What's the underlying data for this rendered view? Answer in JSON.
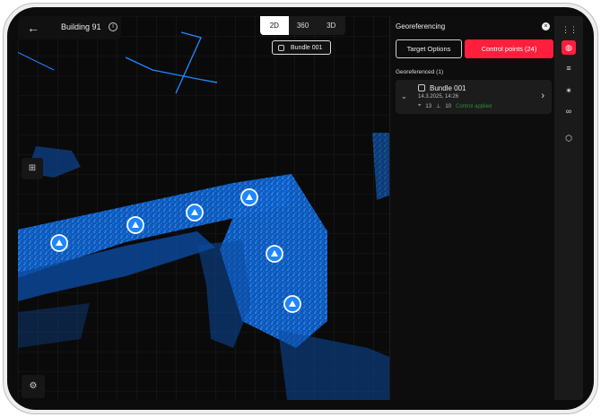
{
  "header": {
    "back_icon": "arrow-left-icon",
    "title": "Building 91",
    "info_icon": "info-icon"
  },
  "view_modes": {
    "options": [
      "2D",
      "360",
      "3D"
    ],
    "selected": "2D"
  },
  "bundle_chip": {
    "label": "Bundle 001",
    "icon": "bundle-icon"
  },
  "panel": {
    "title": "Georeferencing",
    "tabs": [
      {
        "label": "Target Options"
      },
      {
        "label": "Control points (24)"
      }
    ],
    "section_label": "Georeferenced (1)",
    "bundle": {
      "name": "Bundle 001",
      "date": "14.3.2025, 14:26",
      "stat_a": "13",
      "stat_b": "10",
      "status": "Control applied"
    }
  },
  "rail_icons": [
    "grid-icon",
    "globe-icon",
    "layers-icon",
    "survey-tool-icon",
    "link-icon",
    "cube-icon"
  ],
  "colors": {
    "accent": "#ff1f3d",
    "point_cloud": "#1f86ff",
    "status_green": "#2f8a3c"
  }
}
